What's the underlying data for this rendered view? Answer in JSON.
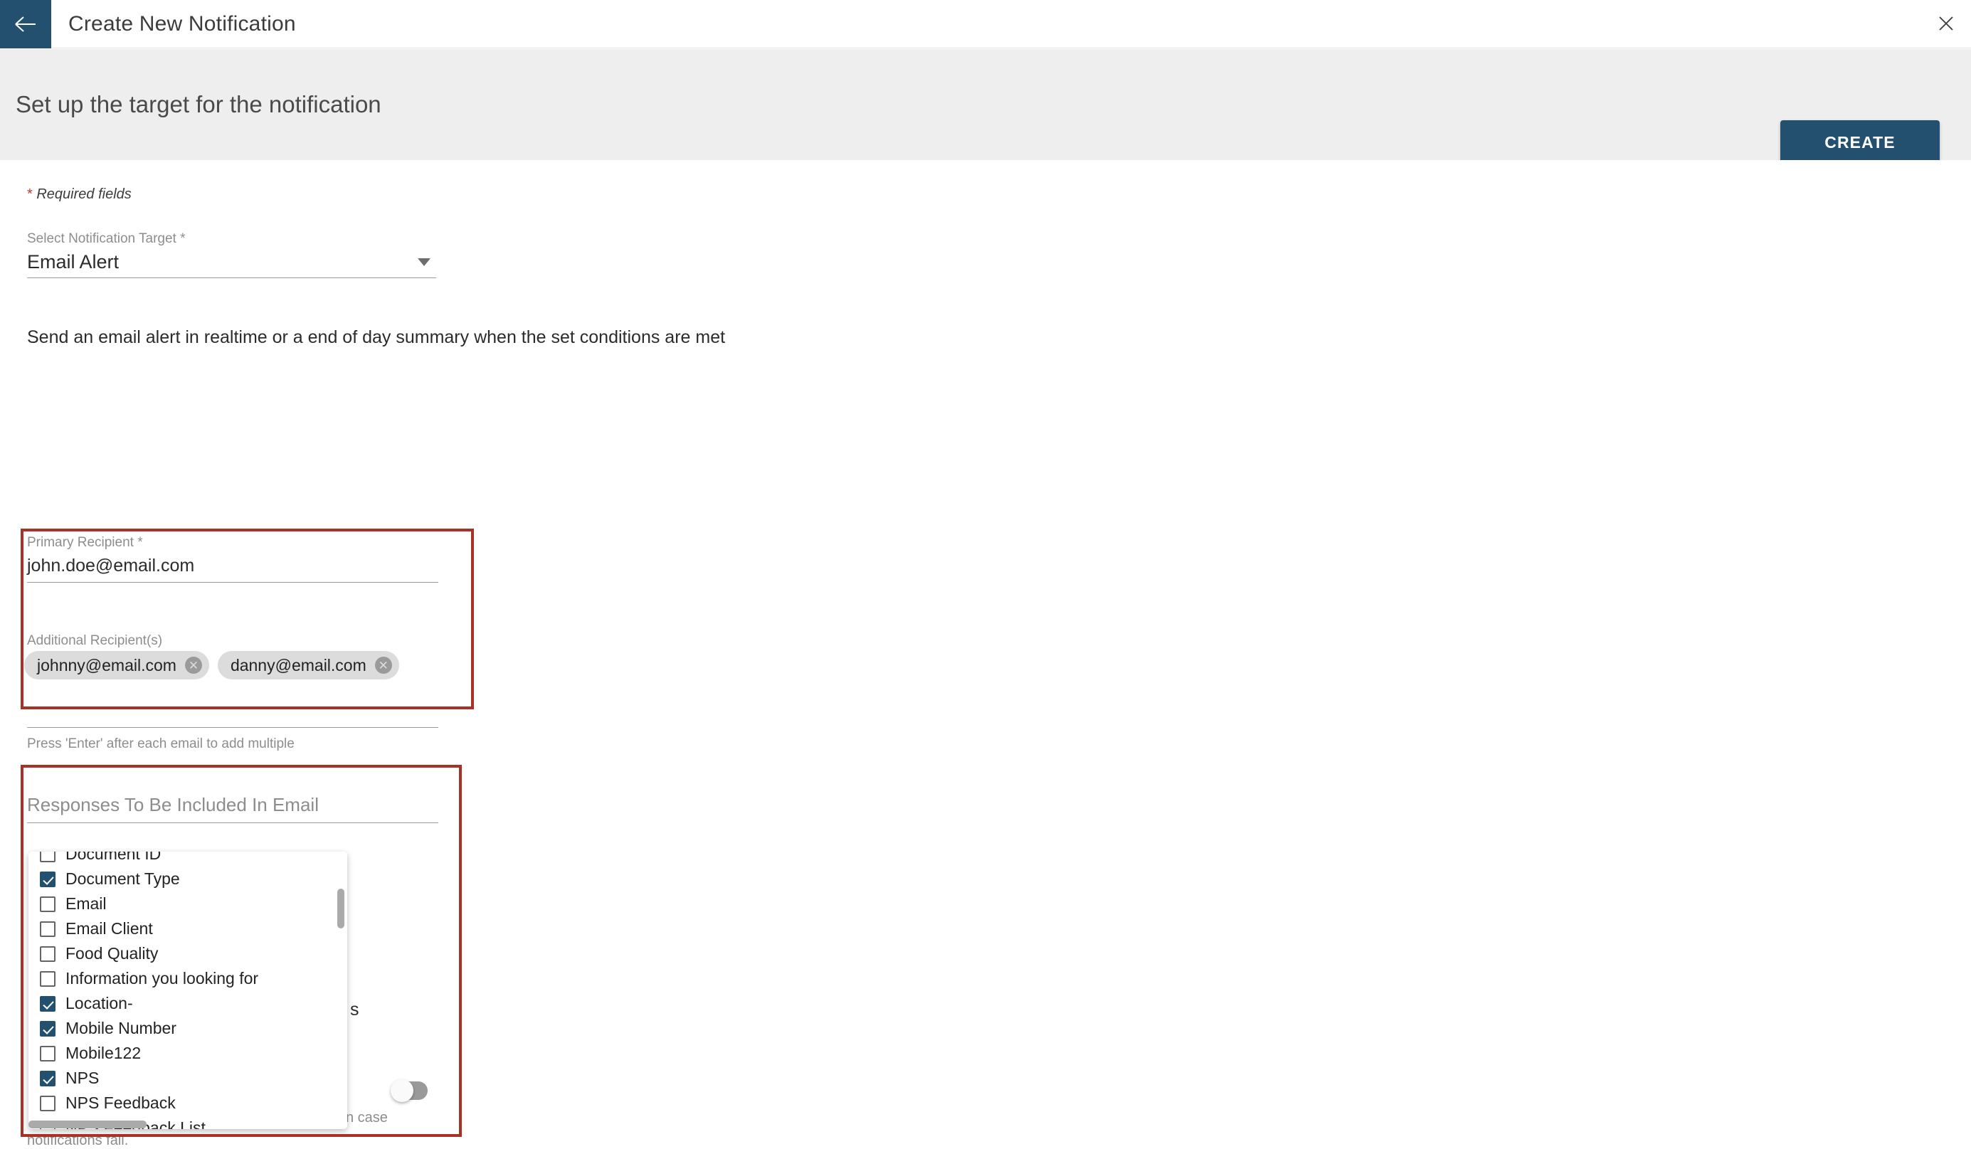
{
  "titlebar": {
    "title": "Create New Notification",
    "back_icon": "arrow-left-icon",
    "close_icon": "close-icon"
  },
  "subheader": {
    "title": "Set up the target for the notification",
    "create_label": "CREATE"
  },
  "form": {
    "required_note_star": "*",
    "required_note_text": "Required fields",
    "target_select": {
      "label": "Select Notification Target *",
      "value": "Email Alert",
      "caret_icon": "chevron-down-icon"
    },
    "description": "Send an email alert in realtime or a end of day summary when the set conditions are met",
    "primary_recipient": {
      "label": "Primary Recipient *",
      "value": "john.doe@email.com"
    },
    "additional_recipients": {
      "label": "Additional Recipient(s)",
      "chips": [
        {
          "email": "johnny@email.com",
          "remove_icon": "remove-chip-icon"
        },
        {
          "email": "danny@email.com",
          "remove_icon": "remove-chip-icon"
        }
      ],
      "hint": "Press 'Enter' after each email to add multiple"
    },
    "responses_field": {
      "placeholder": "Responses To Be Included In Email",
      "value": ""
    }
  },
  "dropdown": {
    "items": [
      {
        "label": "Document ID",
        "checked": false
      },
      {
        "label": "Document Type",
        "checked": true
      },
      {
        "label": "Email",
        "checked": false
      },
      {
        "label": "Email Client",
        "checked": false
      },
      {
        "label": "Food Quality",
        "checked": false
      },
      {
        "label": "Information you looking for",
        "checked": false
      },
      {
        "label": "Location-",
        "checked": true
      },
      {
        "label": "Mobile Number",
        "checked": true
      },
      {
        "label": "Mobile122",
        "checked": false
      },
      {
        "label": "NPS",
        "checked": true
      },
      {
        "label": "NPS Feedback",
        "checked": false
      },
      {
        "label": "NPS Feedback List",
        "checked": false
      }
    ]
  },
  "obscured": {
    "partial_text_right": "s",
    "partial_text_case": "n case",
    "partial_text_fail": "notifications fail.",
    "toggle_on": false
  },
  "colors": {
    "brand_navy": "#23506f",
    "highlight_red": "#a93226",
    "subheader_gray": "#eeeeee",
    "required_star_red": "#c0392b"
  }
}
